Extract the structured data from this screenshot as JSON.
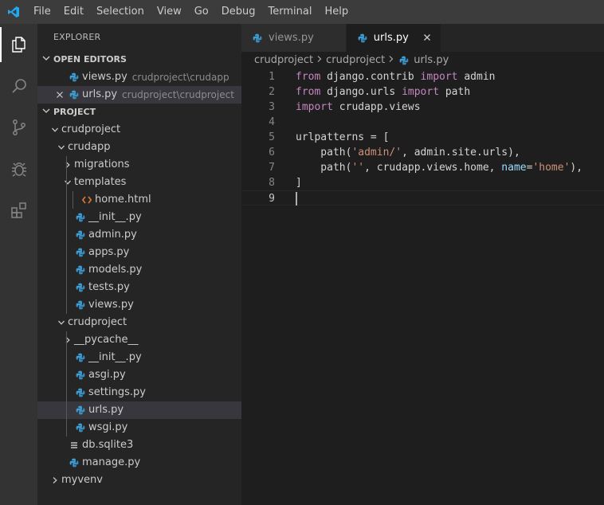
{
  "menu": {
    "items": [
      "File",
      "Edit",
      "Selection",
      "View",
      "Go",
      "Debug",
      "Terminal",
      "Help"
    ]
  },
  "activity_bar": {
    "icons": [
      "explorer-icon",
      "search-icon",
      "source-control-icon",
      "debug-icon",
      "extensions-icon"
    ],
    "active": "explorer-icon"
  },
  "sidebar": {
    "title": "EXPLORER",
    "open_editors": {
      "label": "OPEN EDITORS",
      "items": [
        {
          "name": "views.py",
          "path": "crudproject\\crudapp"
        },
        {
          "name": "urls.py",
          "path": "crudproject\\crudproject"
        }
      ]
    },
    "project": {
      "label": "PROJECT",
      "tree": [
        {
          "label": "crudproject",
          "kind": "folder-open",
          "depth": 0
        },
        {
          "label": "crudapp",
          "kind": "folder-open",
          "depth": 1
        },
        {
          "label": "migrations",
          "kind": "folder-closed",
          "depth": 2
        },
        {
          "label": "templates",
          "kind": "folder-open",
          "depth": 2
        },
        {
          "label": "home.html",
          "kind": "html",
          "depth": 3
        },
        {
          "label": "__init__.py",
          "kind": "py",
          "depth": 2
        },
        {
          "label": "admin.py",
          "kind": "py",
          "depth": 2
        },
        {
          "label": "apps.py",
          "kind": "py",
          "depth": 2
        },
        {
          "label": "models.py",
          "kind": "py",
          "depth": 2
        },
        {
          "label": "tests.py",
          "kind": "py",
          "depth": 2
        },
        {
          "label": "views.py",
          "kind": "py",
          "depth": 2
        },
        {
          "label": "crudproject",
          "kind": "folder-open",
          "depth": 1
        },
        {
          "label": "__pycache__",
          "kind": "folder-closed",
          "depth": 2
        },
        {
          "label": "__init__.py",
          "kind": "py",
          "depth": 2
        },
        {
          "label": "asgi.py",
          "kind": "py",
          "depth": 2
        },
        {
          "label": "settings.py",
          "kind": "py",
          "depth": 2
        },
        {
          "label": "urls.py",
          "kind": "py",
          "depth": 2,
          "selected": true
        },
        {
          "label": "wsgi.py",
          "kind": "py",
          "depth": 2
        },
        {
          "label": "db.sqlite3",
          "kind": "db",
          "depth": 1
        },
        {
          "label": "manage.py",
          "kind": "py",
          "depth": 1
        },
        {
          "label": "myvenv",
          "kind": "folder-closed",
          "depth": 0
        }
      ]
    }
  },
  "editor": {
    "tabs": [
      {
        "label": "views.py",
        "active": false
      },
      {
        "label": "urls.py",
        "active": true
      }
    ],
    "breadcrumb": [
      "crudproject",
      "crudproject",
      "urls.py"
    ],
    "lines": [
      [
        {
          "t": "kw",
          "v": "from"
        },
        {
          "t": "txt",
          "v": " django.contrib "
        },
        {
          "t": "kw",
          "v": "import"
        },
        {
          "t": "txt",
          "v": " admin"
        }
      ],
      [
        {
          "t": "kw",
          "v": "from"
        },
        {
          "t": "txt",
          "v": " django.urls "
        },
        {
          "t": "kw",
          "v": "import"
        },
        {
          "t": "txt",
          "v": " path"
        }
      ],
      [
        {
          "t": "kw",
          "v": "import"
        },
        {
          "t": "txt",
          "v": " crudapp.views"
        }
      ],
      [],
      [
        {
          "t": "txt",
          "v": "urlpatterns = ["
        }
      ],
      [
        {
          "t": "txt",
          "v": "    path("
        },
        {
          "t": "str",
          "v": "'admin/'"
        },
        {
          "t": "txt",
          "v": ", admin.site.urls),"
        }
      ],
      [
        {
          "t": "txt",
          "v": "    path("
        },
        {
          "t": "str",
          "v": "''"
        },
        {
          "t": "txt",
          "v": ", crudapp.views.home, "
        },
        {
          "t": "param",
          "v": "name"
        },
        {
          "t": "txt",
          "v": "="
        },
        {
          "t": "str",
          "v": "'home'"
        },
        {
          "t": "txt",
          "v": "),"
        }
      ],
      [
        {
          "t": "txt",
          "v": "]"
        }
      ],
      []
    ],
    "current_line": 9
  },
  "colors": {
    "python_icon": "#3b9fd8",
    "html_icon": "#e37933",
    "vscode_blue": "#23a9f2"
  }
}
